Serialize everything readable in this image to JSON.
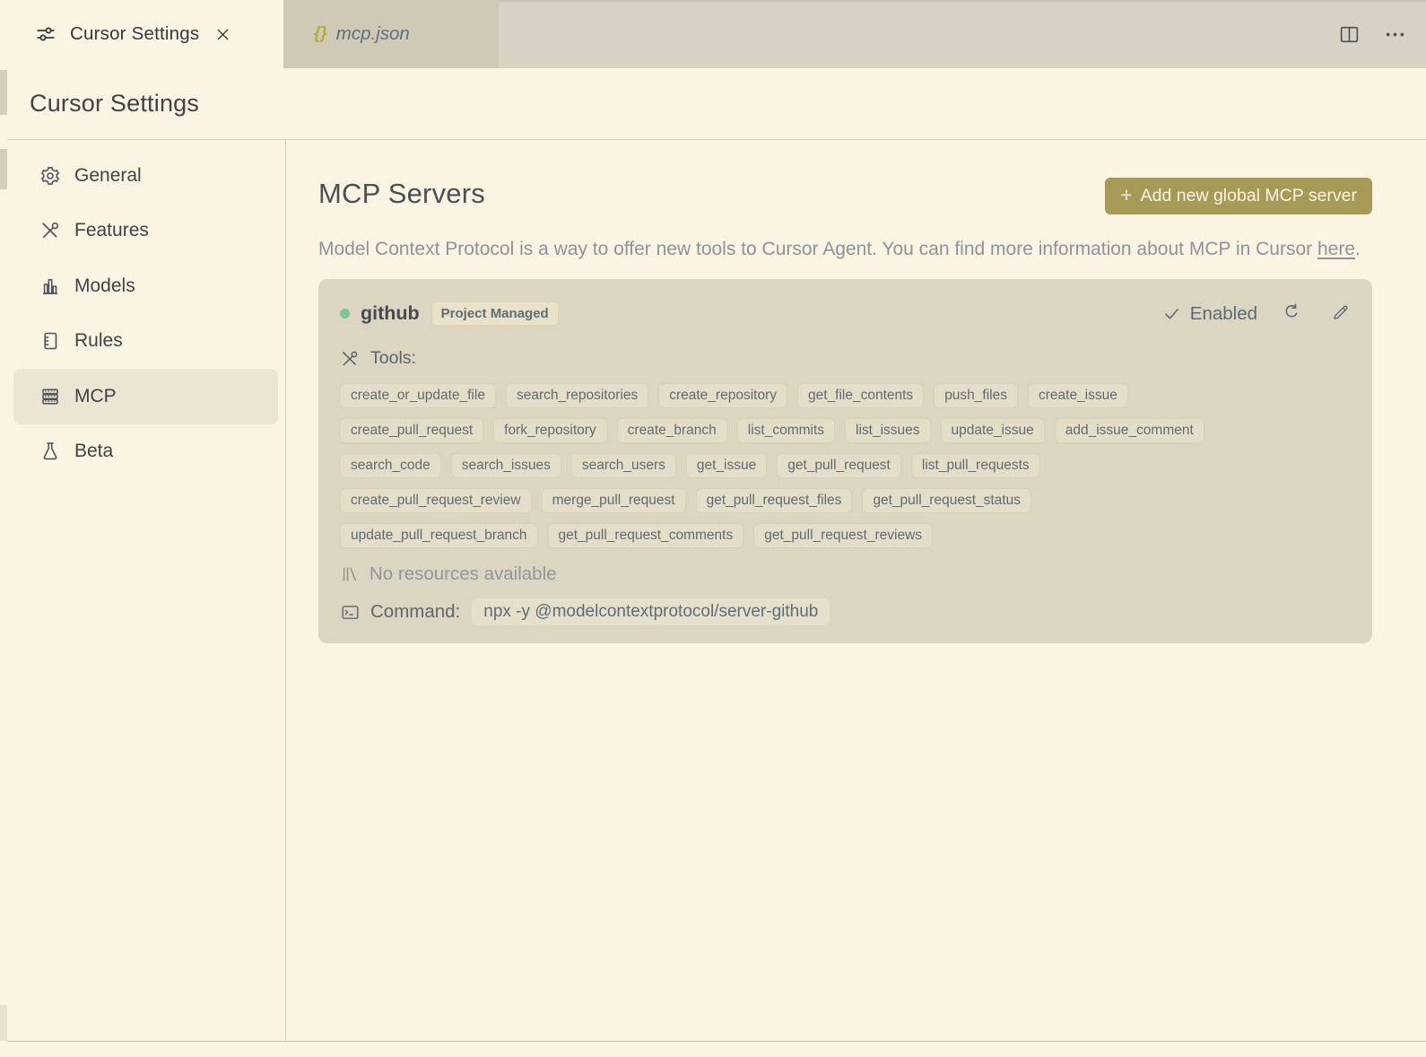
{
  "tabbar": {
    "tabs": [
      {
        "label": "Cursor Settings",
        "icon": "sliders-icon"
      },
      {
        "label": "mcp.json",
        "icon": "braces-icon",
        "braces": "{}"
      }
    ]
  },
  "header": {
    "title": "Cursor Settings"
  },
  "sidebar": {
    "items": [
      {
        "label": "General",
        "icon": "gear-icon"
      },
      {
        "label": "Features",
        "icon": "tools-icon"
      },
      {
        "label": "Models",
        "icon": "bar-chart-icon"
      },
      {
        "label": "Rules",
        "icon": "document-icon"
      },
      {
        "label": "MCP",
        "icon": "server-stack-icon",
        "active": true
      },
      {
        "label": "Beta",
        "icon": "flask-icon"
      }
    ]
  },
  "main": {
    "title": "MCP Servers",
    "add_button": {
      "plus": "+",
      "label": "Add new global MCP server"
    },
    "description": {
      "text": "Model Context Protocol is a way to offer new tools to Cursor Agent. You can find more information about MCP in Cursor ",
      "link": "here",
      "suffix": "."
    },
    "server": {
      "name": "github",
      "badge": "Project Managed",
      "status_label": "Enabled",
      "tools_label": "Tools:",
      "tools_rows": [
        [
          "create_or_update_file",
          "search_repositories",
          "create_repository",
          "get_file_contents",
          "push_files",
          "create_issue"
        ],
        [
          "create_pull_request",
          "fork_repository",
          "create_branch",
          "list_commits",
          "list_issues",
          "update_issue",
          "add_issue_comment"
        ],
        [
          "search_code",
          "search_issues",
          "search_users",
          "get_issue",
          "get_pull_request",
          "list_pull_requests"
        ],
        [
          "create_pull_request_review",
          "merge_pull_request",
          "get_pull_request_files",
          "get_pull_request_status"
        ],
        [
          "update_pull_request_branch",
          "get_pull_request_comments",
          "get_pull_request_reviews"
        ]
      ],
      "resources_text": "No resources available",
      "command_label": "Command:",
      "command_value": "npx -y @modelcontextprotocol/server-github"
    }
  },
  "colors": {
    "page_bg": "#fbf4e3",
    "tabstrip_bg": "#d7d2c3",
    "inactive_tab_bg": "#cfc9b6",
    "card_bg": "#dcd5c1",
    "chip_bg": "#e4ddc7",
    "accent_button": "#a69a56",
    "braces_olive": "#b2ae3e",
    "status_green": "#7cc79a",
    "slate_text": "#5d6e7a"
  }
}
